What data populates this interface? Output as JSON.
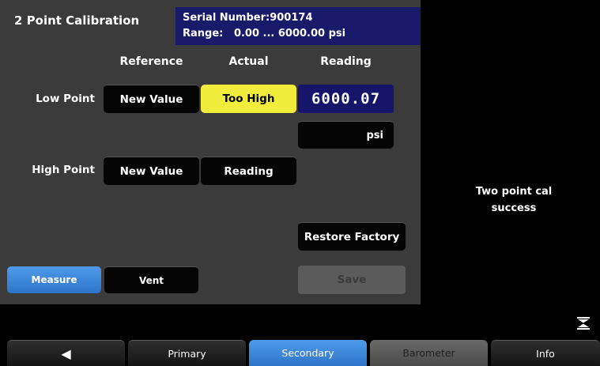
{
  "header": {
    "title": "2 Point Calibration",
    "serial_label": "Serial Number:",
    "serial_value": "900174",
    "range_label": "Range:",
    "range_value": "0.00 ... 6000.00 psi"
  },
  "columns": {
    "reference": "Reference",
    "actual": "Actual",
    "reading": "Reading"
  },
  "low_point": {
    "label": "Low Point",
    "reference_button": "New Value",
    "actual_button": "Too High",
    "reading_value": "6000.07",
    "unit": "psi"
  },
  "high_point": {
    "label": "High Point",
    "reference_button": "New Value",
    "actual_button": "Reading"
  },
  "actions": {
    "restore_factory": "Restore Factory",
    "save": "Save",
    "measure": "Measure",
    "vent": "Vent"
  },
  "status": {
    "line1": "Two point cal",
    "line2": "success"
  },
  "tabs": {
    "back_symbol": "◀",
    "primary": "Primary",
    "secondary": "Secondary",
    "barometer": "Barometer",
    "info": "Info"
  },
  "colors": {
    "panel": "#3b3b3b",
    "accent_blue": "#2d74c9",
    "reading_bg": "#16156a",
    "warning_yellow": "#f2ec3c"
  },
  "icons": {
    "collapse": "collapse-arrows-icon",
    "back": "back-arrow-icon"
  }
}
